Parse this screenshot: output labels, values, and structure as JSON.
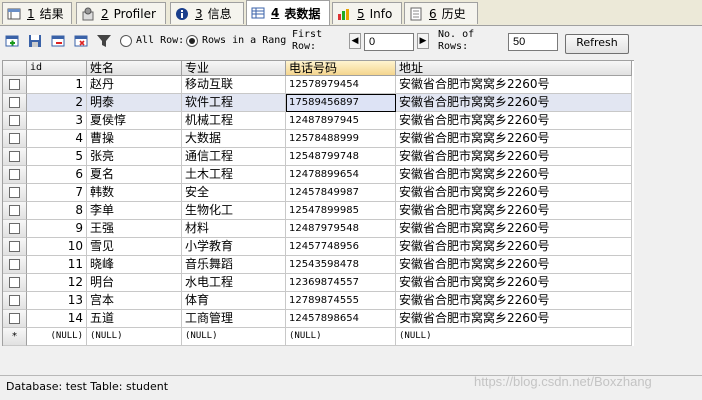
{
  "tabs": [
    {
      "num": "1",
      "label": "结果",
      "icon": "result-icon"
    },
    {
      "num": "2",
      "label": "Profiler",
      "icon": "profiler-icon"
    },
    {
      "num": "3",
      "label": "信息",
      "icon": "info-icon"
    },
    {
      "num": "4",
      "label": "表数据",
      "icon": "table-icon",
      "active": true
    },
    {
      "num": "5",
      "label": "Info",
      "icon": "chart-icon"
    },
    {
      "num": "6",
      "label": "历史",
      "icon": "history-icon"
    }
  ],
  "toolbar": {
    "all_rows_label": "All Row:",
    "range_label": "Rows in a Rang",
    "first_row_label": "First Row:",
    "first_row_value": "0",
    "num_rows_label": "No. of Rows:",
    "num_rows_value": "50",
    "refresh_label": "Refresh"
  },
  "columns": [
    "id",
    "姓名",
    "专业",
    "电话号码",
    "地址"
  ],
  "rows": [
    {
      "id": "1",
      "name": "赵丹",
      "major": "移动互联",
      "phone": "12578979454",
      "addr": "安徽省合肥市窝窝乡2260号"
    },
    {
      "id": "2",
      "name": "明泰",
      "major": "软件工程",
      "phone": "17589456897",
      "addr": "安徽省合肥市窝窝乡2260号"
    },
    {
      "id": "3",
      "name": "夏侯惇",
      "major": "机械工程",
      "phone": "12487897945",
      "addr": "安徽省合肥市窝窝乡2260号"
    },
    {
      "id": "4",
      "name": "曹操",
      "major": "大数据",
      "phone": "12578488999",
      "addr": "安徽省合肥市窝窝乡2260号"
    },
    {
      "id": "5",
      "name": "张亮",
      "major": "通信工程",
      "phone": "12548799748",
      "addr": "安徽省合肥市窝窝乡2260号"
    },
    {
      "id": "6",
      "name": "夏名",
      "major": "土木工程",
      "phone": "12478899654",
      "addr": "安徽省合肥市窝窝乡2260号"
    },
    {
      "id": "7",
      "name": "韩数",
      "major": "安全",
      "phone": "12457849987",
      "addr": "安徽省合肥市窝窝乡2260号"
    },
    {
      "id": "8",
      "name": "李单",
      "major": "生物化工",
      "phone": "12547899985",
      "addr": "安徽省合肥市窝窝乡2260号"
    },
    {
      "id": "9",
      "name": "王强",
      "major": "材料",
      "phone": "12487979548",
      "addr": "安徽省合肥市窝窝乡2260号"
    },
    {
      "id": "10",
      "name": "雪见",
      "major": "小学教育",
      "phone": "12457748956",
      "addr": "安徽省合肥市窝窝乡2260号"
    },
    {
      "id": "11",
      "name": "晓峰",
      "major": "音乐舞蹈",
      "phone": "12543598478",
      "addr": "安徽省合肥市窝窝乡2260号"
    },
    {
      "id": "12",
      "name": "明台",
      "major": "水电工程",
      "phone": "12369874557",
      "addr": "安徽省合肥市窝窝乡2260号"
    },
    {
      "id": "13",
      "name": "宫本",
      "major": "体育",
      "phone": "12789874555",
      "addr": "安徽省合肥市窝窝乡2260号"
    },
    {
      "id": "14",
      "name": "五道",
      "major": "工商管理",
      "phone": "12457898654",
      "addr": "安徽省合肥市窝窝乡2260号"
    }
  ],
  "new_row": {
    "marker": "*",
    "null": "(NULL)"
  },
  "status": {
    "text": "Database: test  Table: student"
  },
  "watermark": "https://blog.csdn.net/Boxzhang",
  "colors": {
    "header_highlight": "#f4d58e",
    "selected_row": "#e2e6f2"
  }
}
